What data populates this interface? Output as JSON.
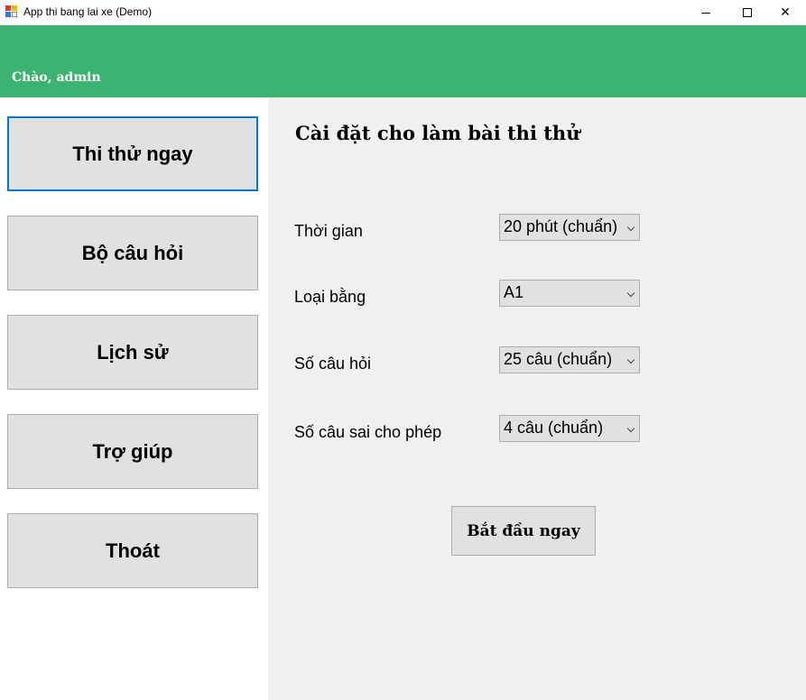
{
  "window": {
    "title": "App thi bang lai xe (Demo)",
    "icons": {
      "app": "app-icon",
      "minimize": "minimize-icon",
      "maximize": "maximize-icon",
      "close": "close-icon"
    },
    "close_glyph": "✕"
  },
  "header": {
    "greeting": "Chào, admin",
    "color": "#3cb371"
  },
  "sidebar": {
    "items": [
      {
        "label": "Thi thử ngay",
        "active": true
      },
      {
        "label": "Bộ câu hỏi",
        "active": false
      },
      {
        "label": "Lịch sử",
        "active": false
      },
      {
        "label": "Trợ giúp",
        "active": false
      },
      {
        "label": "Thoát",
        "active": false
      }
    ],
    "active_border_color": "#0078d7"
  },
  "settings": {
    "title": "Cài đặt cho làm bài thi thử",
    "fields": [
      {
        "label": "Thời gian",
        "value": "20 phút (chuẩn)"
      },
      {
        "label": "Loại bằng",
        "value": "A1"
      },
      {
        "label": "Số câu hỏi",
        "value": "25 câu (chuẩn)"
      },
      {
        "label": "Số câu sai cho phép",
        "value": "4 câu (chuẩn)"
      }
    ],
    "start_button": "Bắt đầu ngay"
  }
}
